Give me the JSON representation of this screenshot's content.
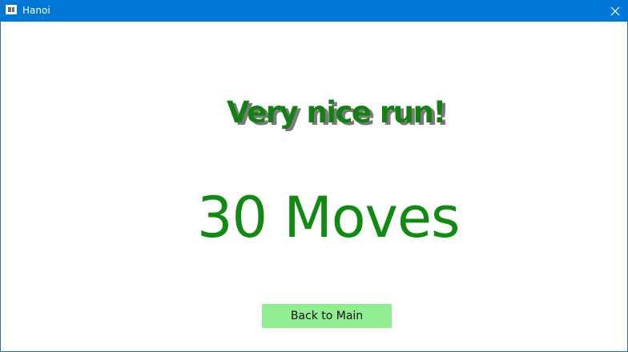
{
  "window": {
    "title": "Hanoi",
    "app_icon": "window-app-icon",
    "close_icon": "close-icon"
  },
  "result": {
    "headline": "Very nice run!",
    "moves_text": "30 Moves"
  },
  "actions": {
    "back_label": "Back to Main"
  },
  "colors": {
    "titlebar": "#0078d7",
    "headline_text": "#138013",
    "headline_shadow": "#7a7a7a",
    "moves_text": "#108a10",
    "button_background": "#90ee90"
  }
}
